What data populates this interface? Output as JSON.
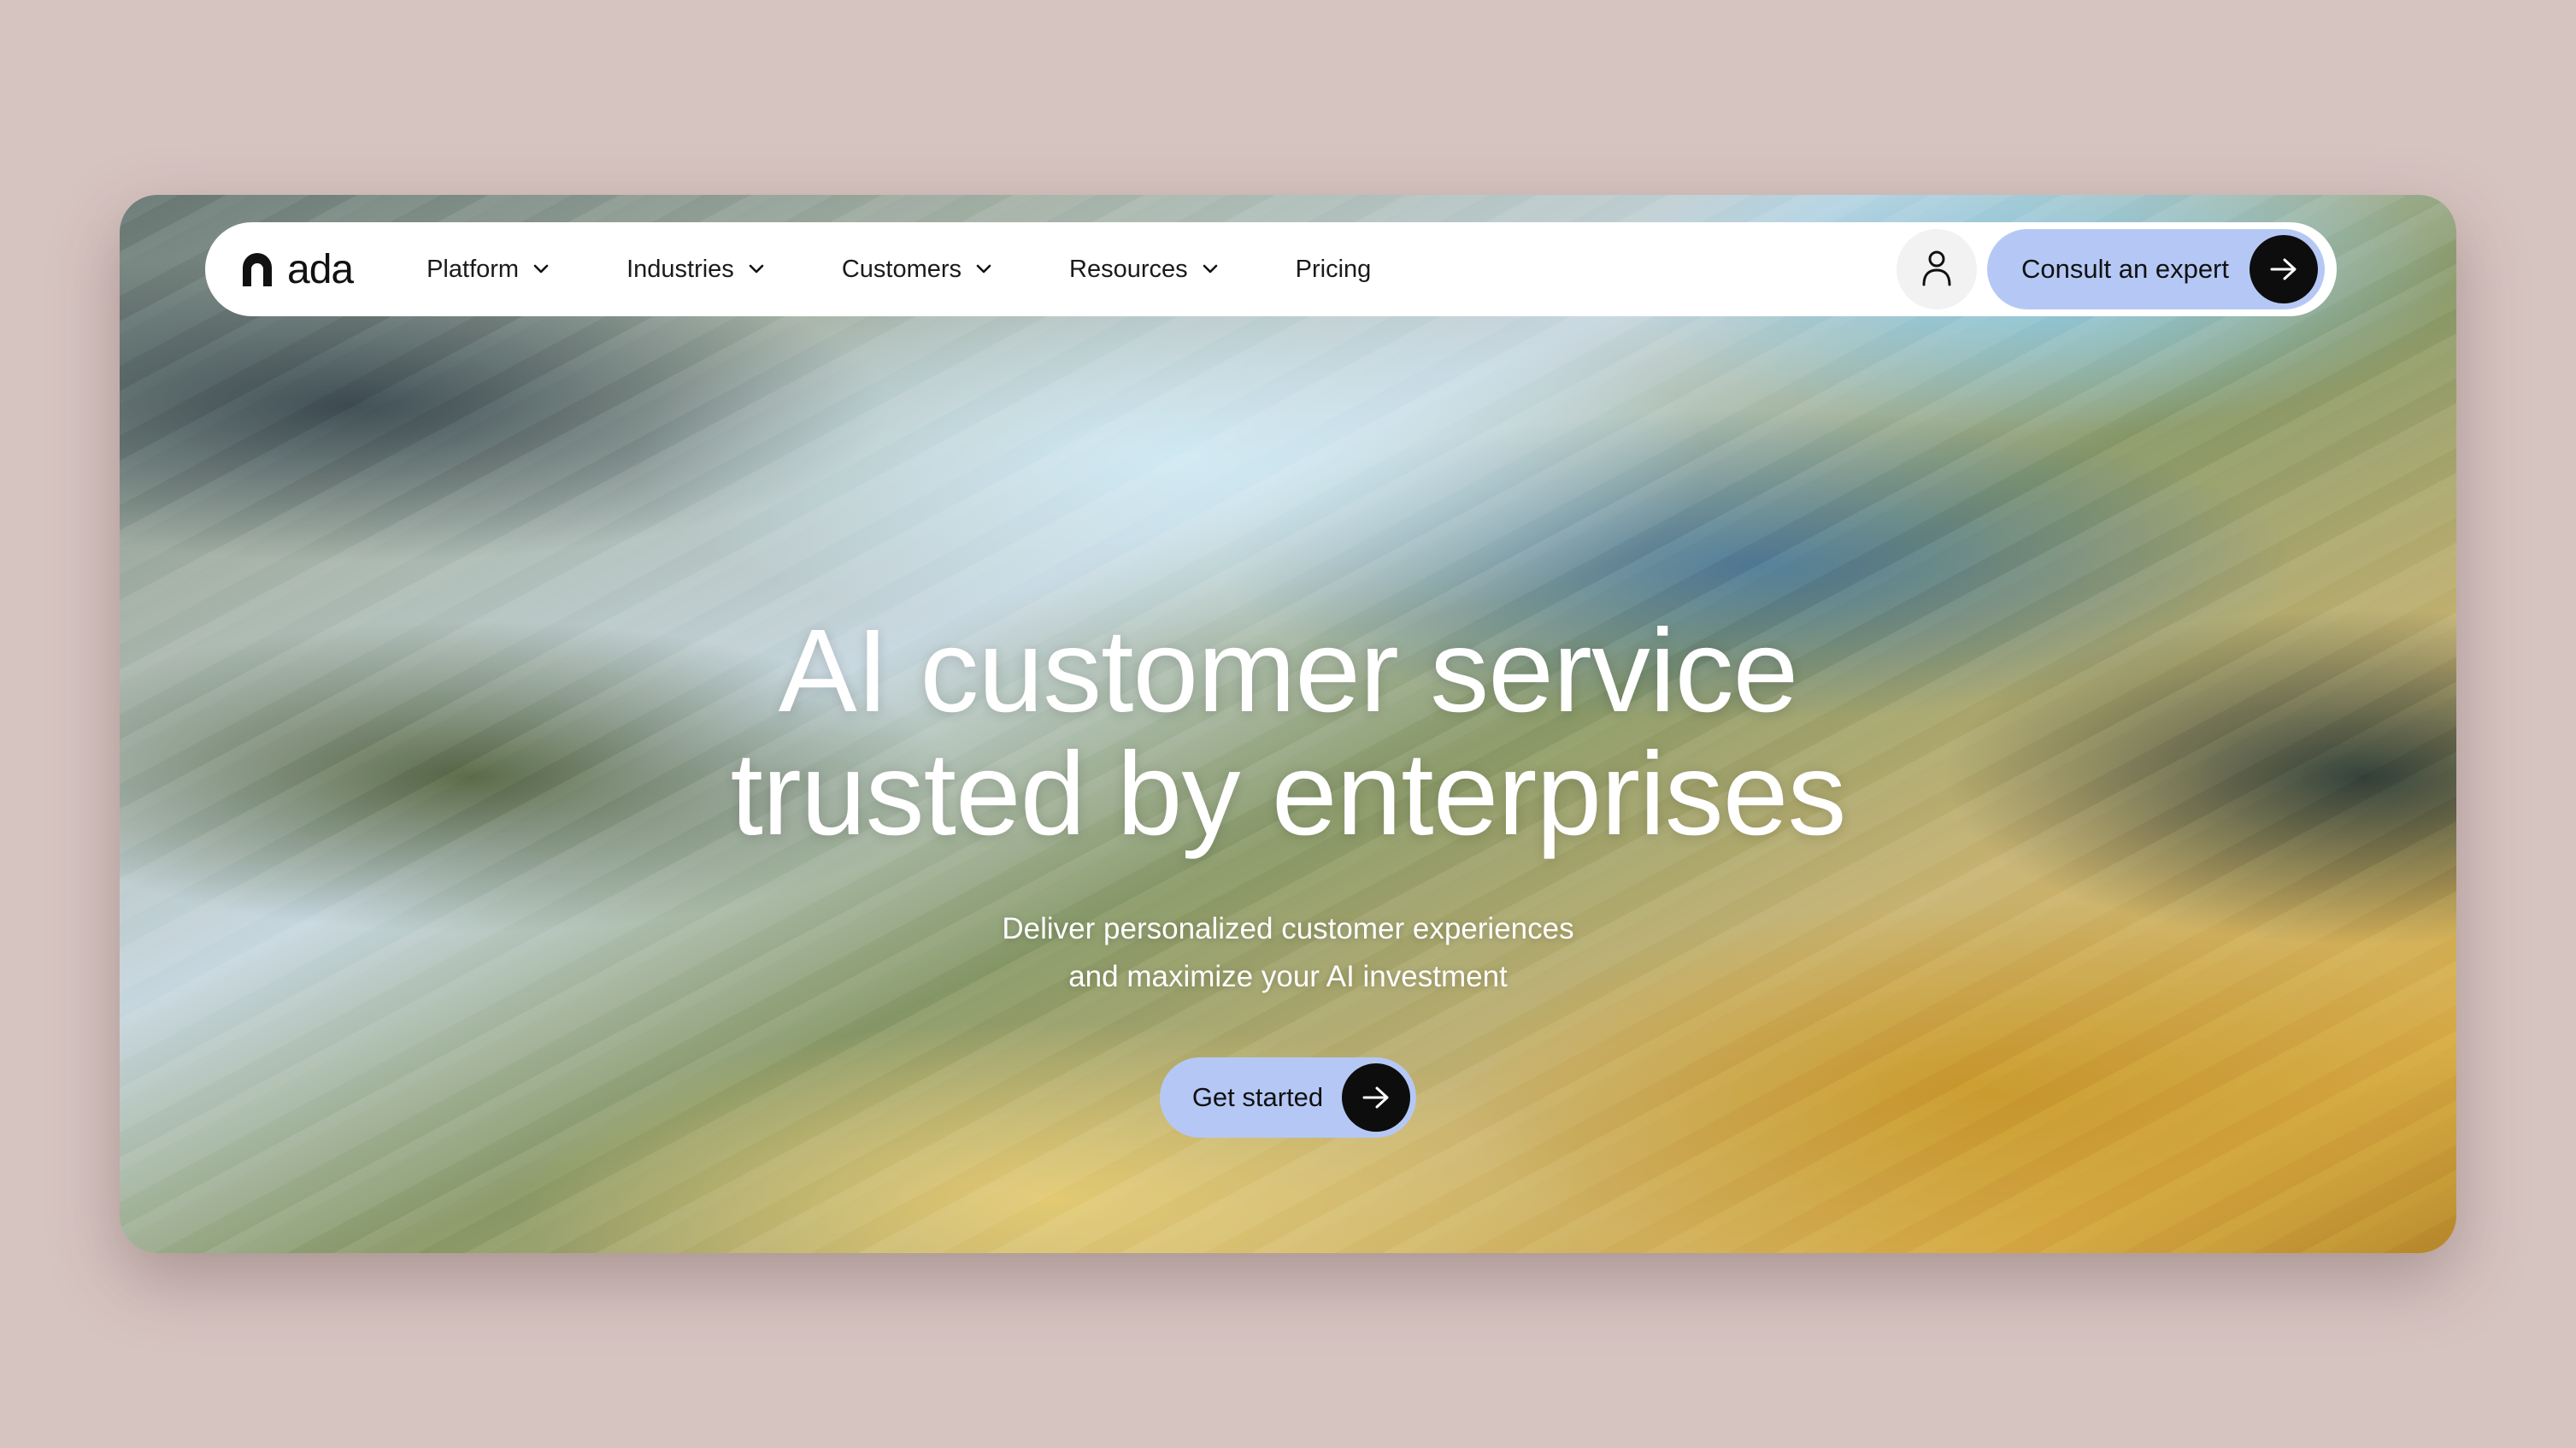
{
  "brand": {
    "name": "ada",
    "logo_icon": "ada-arch-logo-icon"
  },
  "nav": {
    "items": [
      {
        "label": "Platform",
        "has_dropdown": true
      },
      {
        "label": "Industries",
        "has_dropdown": true
      },
      {
        "label": "Customers",
        "has_dropdown": true
      },
      {
        "label": "Resources",
        "has_dropdown": true
      },
      {
        "label": "Pricing",
        "has_dropdown": false
      }
    ],
    "account_icon": "user-icon",
    "cta_label": "Consult an expert"
  },
  "hero": {
    "title_line1": "AI customer service",
    "title_line2": "trusted by enterprises",
    "subtitle_line1": "Deliver personalized customer experiences",
    "subtitle_line2": "and maximize your AI investment",
    "cta_label": "Get started"
  },
  "colors": {
    "page_background": "#d6c4c1",
    "cta_background": "#b5c8f5",
    "arrow_circle": "#0d0d0d",
    "nav_background": "#ffffff",
    "hero_text": "#ffffff"
  }
}
